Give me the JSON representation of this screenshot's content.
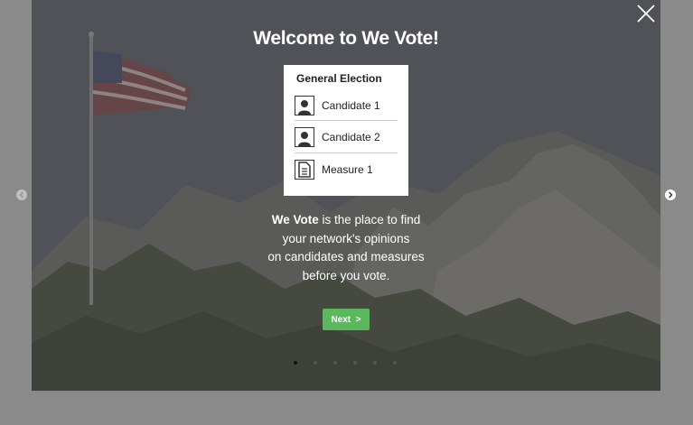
{
  "modal": {
    "title": "Welcome to We Vote!",
    "close_icon": "close-icon",
    "prev_icon": "chevron-left-icon",
    "next_arrow_icon": "chevron-right-icon"
  },
  "ballot_card": {
    "heading": "General Election",
    "items": [
      {
        "label": "Candidate 1",
        "icon": "person-icon"
      },
      {
        "label": "Candidate 2",
        "icon": "person-icon"
      },
      {
        "label": "Measure 1",
        "icon": "document-icon"
      }
    ]
  },
  "description": {
    "brand": "We Vote",
    "line1_rest": " is the place to find",
    "line2": "your network's opinions",
    "line3": "on candidates and measures",
    "line4": "before you vote."
  },
  "next_button": {
    "label": "Next  >"
  },
  "pagination": {
    "total": 6,
    "active_index": 0
  },
  "colors": {
    "next_button": "#5cb85c",
    "backdrop": "#8a8a8a"
  }
}
